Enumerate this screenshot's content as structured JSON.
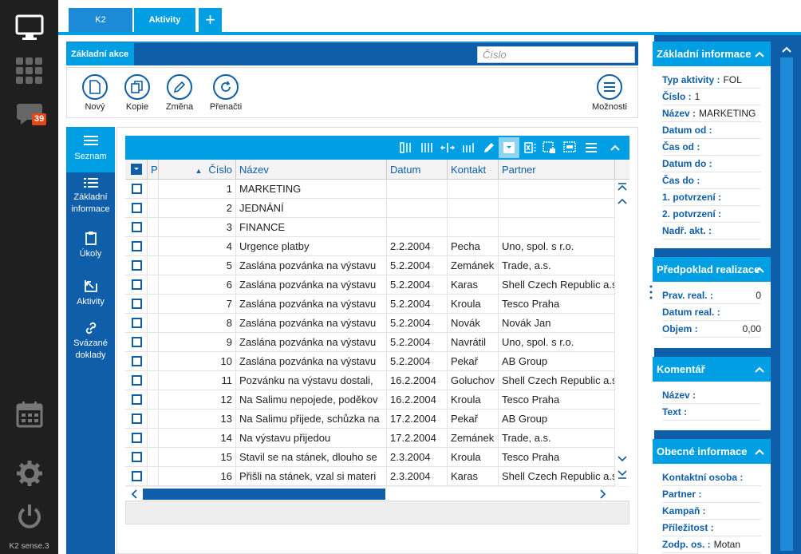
{
  "sidebar": {
    "badge_count": "39",
    "version": "K2 sense.3"
  },
  "tabs": [
    {
      "label": "K2"
    },
    {
      "label": "Aktivity"
    },
    {
      "label": "+"
    }
  ],
  "actions": {
    "label": "Základní akce",
    "search_placeholder": "Číslo"
  },
  "toolbar": {
    "new": "Nový",
    "copy": "Kopie",
    "change": "Změna",
    "reload": "Přenačti",
    "options": "Možnosti"
  },
  "leftnav": [
    {
      "label": "Seznam"
    },
    {
      "label": "Základní informace"
    },
    {
      "label": "Úkoly"
    },
    {
      "label": "Aktivity"
    },
    {
      "label": "Svázané doklady"
    }
  ],
  "grid": {
    "columns": [
      "P",
      "Číslo",
      "Název",
      "Datum",
      "Kontakt",
      "Partner"
    ],
    "rows": [
      {
        "cislo": "1",
        "nazev": "MARKETING",
        "datum": "",
        "kontakt": "",
        "partner": ""
      },
      {
        "cislo": "2",
        "nazev": "JEDNÁNÍ",
        "datum": "",
        "kontakt": "",
        "partner": ""
      },
      {
        "cislo": "3",
        "nazev": "FINANCE",
        "datum": "",
        "kontakt": "",
        "partner": ""
      },
      {
        "cislo": "4",
        "nazev": "Urgence platby",
        "datum": "2.2.2004",
        "kontakt": "Pecha",
        "partner": "Uno, spol. s r.o."
      },
      {
        "cislo": "5",
        "nazev": "Zaslána pozvánka na výstavu",
        "datum": "5.2.2004",
        "kontakt": "Zemánek",
        "partner": "Trade, a.s."
      },
      {
        "cislo": "6",
        "nazev": "Zaslána pozvánka na výstavu",
        "datum": "5.2.2004",
        "kontakt": "Karas",
        "partner": "Shell Czech Republic a.s."
      },
      {
        "cislo": "7",
        "nazev": "Zaslána pozvánka na výstavu",
        "datum": "5.2.2004",
        "kontakt": "Kroula",
        "partner": "Tesco Praha"
      },
      {
        "cislo": "8",
        "nazev": "Zaslána pozvánka na výstavu",
        "datum": "5.2.2004",
        "kontakt": "Novák",
        "partner": "Novák Jan"
      },
      {
        "cislo": "9",
        "nazev": "Zaslána pozvánka na výstavu",
        "datum": "5.2.2004",
        "kontakt": "Navrátil",
        "partner": "Uno, spol. s r.o."
      },
      {
        "cislo": "10",
        "nazev": "Zaslána pozvánka na výstavu",
        "datum": "5.2.2004",
        "kontakt": "Pekař",
        "partner": "AB Group"
      },
      {
        "cislo": "11",
        "nazev": "Pozvánku na výstavu dostali,",
        "datum": "16.2.2004",
        "kontakt": "Goluchov",
        "partner": "Shell Czech Republic a.s."
      },
      {
        "cislo": "12",
        "nazev": "Na Salimu nepojede, poděkov",
        "datum": "16.2.2004",
        "kontakt": "Kroula",
        "partner": "Tesco Praha"
      },
      {
        "cislo": "13",
        "nazev": "Na Salimu přijede, schůzka na",
        "datum": "17.2.2004",
        "kontakt": "Pekař",
        "partner": "AB Group"
      },
      {
        "cislo": "14",
        "nazev": "Na výstavu přijedou",
        "datum": "17.2.2004",
        "kontakt": "Zemánek",
        "partner": "Trade, a.s."
      },
      {
        "cislo": "15",
        "nazev": "Stavil se na stánek, dlouho se",
        "datum": "2.3.2004",
        "kontakt": "Kroula",
        "partner": "Tesco Praha"
      },
      {
        "cislo": "16",
        "nazev": "Přišli na stánek, vzal si materi",
        "datum": "2.3.2004",
        "kontakt": "Karas",
        "partner": "Shell Czech Republic a.s."
      }
    ]
  },
  "panels": {
    "basic": {
      "title": "Základní informace",
      "fields": [
        {
          "label": "Typ aktivity :",
          "value": "FOL"
        },
        {
          "label": "Číslo :",
          "value": "1"
        },
        {
          "label": "Název :",
          "value": "MARKETING"
        },
        {
          "label": "Datum od :",
          "value": ""
        },
        {
          "label": "Čas od :",
          "value": ""
        },
        {
          "label": "Datum do :",
          "value": ""
        },
        {
          "label": "Čas do :",
          "value": ""
        },
        {
          "label": "1. potvrzení :",
          "value": ""
        },
        {
          "label": "2. potvrzení :",
          "value": ""
        },
        {
          "label": "Nadř. akt. :",
          "value": ""
        }
      ]
    },
    "predpoklad": {
      "title": "Předpoklad realizace",
      "fields": [
        {
          "label": "Prav. real. :",
          "value": "0"
        },
        {
          "label": "Datum real. :",
          "value": ""
        },
        {
          "label": "Objem :",
          "value": "0,00"
        }
      ]
    },
    "komentar": {
      "title": "Komentář",
      "fields": [
        {
          "label": "Název :",
          "value": ""
        },
        {
          "label": "Text :",
          "value": ""
        }
      ]
    },
    "obecne": {
      "title": "Obecné informace",
      "fields": [
        {
          "label": "Kontaktní osoba :",
          "value": ""
        },
        {
          "label": "Partner :",
          "value": ""
        },
        {
          "label": "Kampaň :",
          "value": ""
        },
        {
          "label": "Příležitost :",
          "value": ""
        },
        {
          "label": "Zodp. os. :",
          "value": "Motan"
        }
      ]
    }
  }
}
